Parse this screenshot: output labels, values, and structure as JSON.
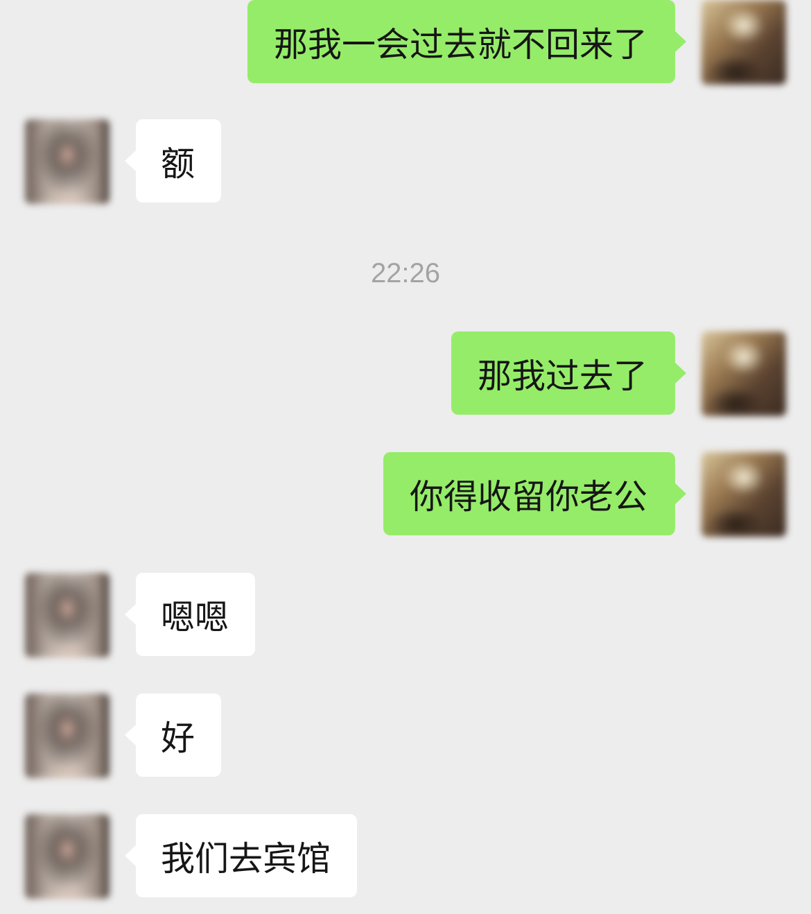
{
  "chat": {
    "timestamp": "22:26",
    "messages": [
      {
        "sender": "self",
        "text": "那我一会过去就不回来了"
      },
      {
        "sender": "other",
        "text": "额"
      },
      {
        "sender": "self",
        "text": "那我过去了"
      },
      {
        "sender": "self",
        "text": "你得收留你老公"
      },
      {
        "sender": "other",
        "text": "嗯嗯"
      },
      {
        "sender": "other",
        "text": "好"
      },
      {
        "sender": "other",
        "text": "我们去宾馆"
      }
    ]
  },
  "colors": {
    "background": "#ededed",
    "sent_bubble": "#95ec69",
    "received_bubble": "#ffffff",
    "timestamp_text": "#a3a3a3"
  }
}
